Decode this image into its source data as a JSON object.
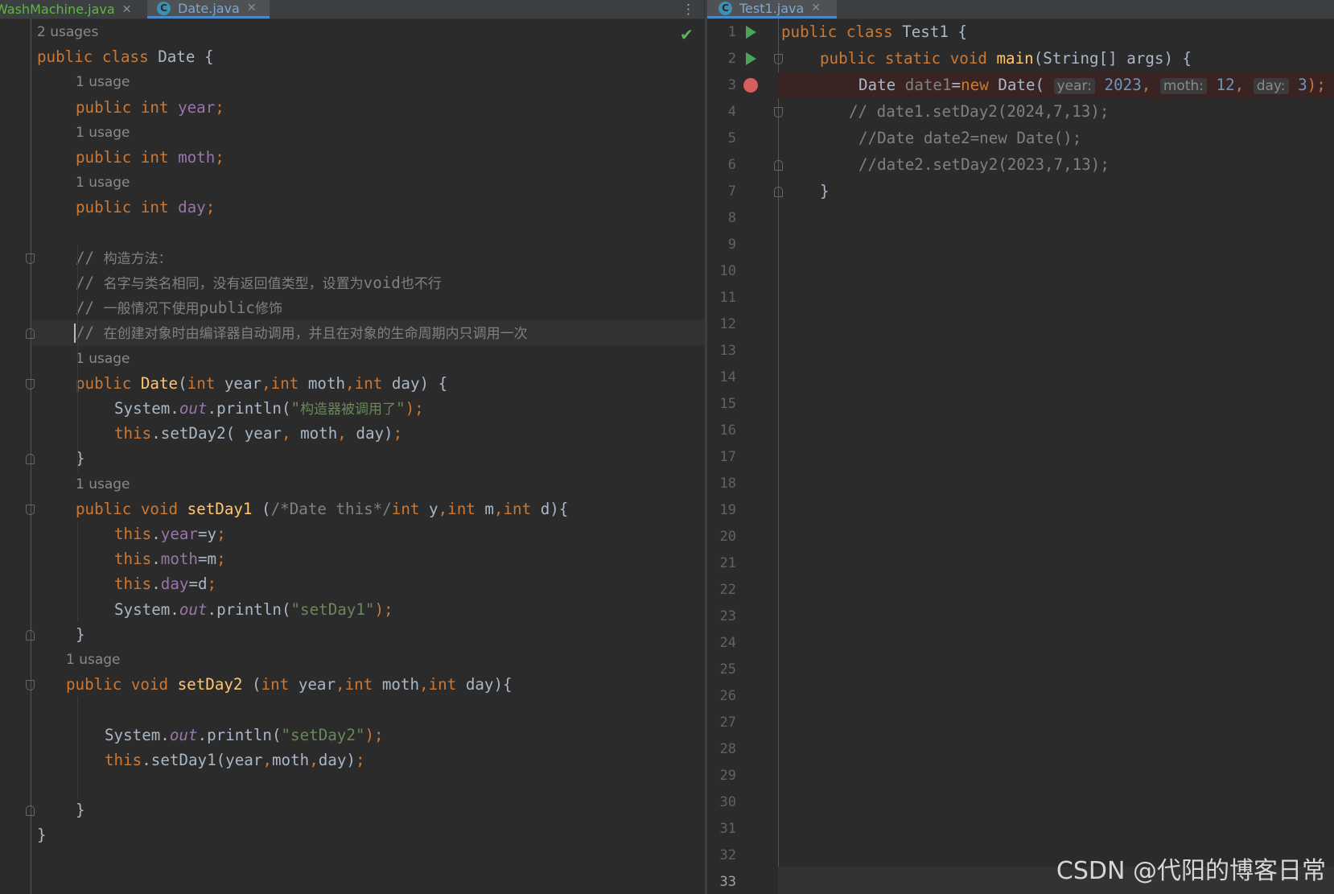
{
  "left_tabs": [
    {
      "name": "WashMachine.java"
    },
    {
      "name": "Date.java",
      "active": true
    }
  ],
  "right_tabs": [
    {
      "name": "Test1.java",
      "active": true
    }
  ],
  "tab_icon_letter": "C",
  "left_editor": {
    "lines": [
      {
        "kind": "usage",
        "indent": 0,
        "text": "2 usages"
      },
      {
        "kind": "code",
        "indent": 0,
        "tokens": [
          {
            "t": "public class ",
            "c": "kw"
          },
          {
            "t": "Date {",
            "c": "plain"
          }
        ]
      },
      {
        "kind": "usage",
        "indent": 1,
        "text": "1 usage"
      },
      {
        "kind": "code",
        "indent": 1,
        "tokens": [
          {
            "t": "public int ",
            "c": "kw"
          },
          {
            "t": "year",
            "c": "fld"
          },
          {
            "t": ";",
            "c": "kw"
          }
        ]
      },
      {
        "kind": "usage",
        "indent": 1,
        "text": "1 usage"
      },
      {
        "kind": "code",
        "indent": 1,
        "tokens": [
          {
            "t": "public int ",
            "c": "kw"
          },
          {
            "t": "moth",
            "c": "fld"
          },
          {
            "t": ";",
            "c": "kw"
          }
        ]
      },
      {
        "kind": "usage",
        "indent": 1,
        "text": "1 usage"
      },
      {
        "kind": "code",
        "indent": 1,
        "tokens": [
          {
            "t": "public int ",
            "c": "kw"
          },
          {
            "t": "day",
            "c": "fld"
          },
          {
            "t": ";",
            "c": "kw"
          }
        ]
      },
      {
        "kind": "blank"
      },
      {
        "kind": "code",
        "indent": 1,
        "tokens": [
          {
            "t": "// ",
            "c": "cmt"
          },
          {
            "t": "构造方法：",
            "c": "cmt cn"
          }
        ]
      },
      {
        "kind": "code",
        "indent": 1,
        "tokens": [
          {
            "t": "// ",
            "c": "cmt"
          },
          {
            "t": "名字与类名相同，没有返回值类型，设置为",
            "c": "cmt cn"
          },
          {
            "t": "void",
            "c": "cmt"
          },
          {
            "t": "也不行",
            "c": "cmt cn"
          }
        ]
      },
      {
        "kind": "code",
        "indent": 1,
        "tokens": [
          {
            "t": "// ",
            "c": "cmt"
          },
          {
            "t": "一般情况下使用",
            "c": "cmt cn"
          },
          {
            "t": "public",
            "c": "cmt"
          },
          {
            "t": "修饰",
            "c": "cmt cn"
          }
        ]
      },
      {
        "kind": "code",
        "indent": 1,
        "caret": true,
        "tokens": [
          {
            "t": "// ",
            "c": "cmt"
          },
          {
            "t": "在创建对象时由编译器自动调用，并且在对象的生命周期内只调用一次",
            "c": "cmt cn"
          }
        ]
      },
      {
        "kind": "usage",
        "indent": 1,
        "text": "1 usage"
      },
      {
        "kind": "code",
        "indent": 1,
        "tokens": [
          {
            "t": "public ",
            "c": "kw"
          },
          {
            "t": "Date",
            "c": "fn"
          },
          {
            "t": "(",
            "c": "plain"
          },
          {
            "t": "int ",
            "c": "kw"
          },
          {
            "t": "year",
            "c": "plain"
          },
          {
            "t": ",",
            "c": "kw"
          },
          {
            "t": "int ",
            "c": "kw"
          },
          {
            "t": "moth",
            "c": "plain"
          },
          {
            "t": ",",
            "c": "kw"
          },
          {
            "t": "int ",
            "c": "kw"
          },
          {
            "t": "day) {",
            "c": "plain"
          }
        ]
      },
      {
        "kind": "code",
        "indent": 2,
        "tokens": [
          {
            "t": "System.",
            "c": "plain"
          },
          {
            "t": "out",
            "c": "it"
          },
          {
            "t": ".println(",
            "c": "plain"
          },
          {
            "t": "\"",
            "c": "str"
          },
          {
            "t": "构造器被调用了",
            "c": "str cn"
          },
          {
            "t": "\"",
            "c": "str"
          },
          {
            "t": ");",
            "c": "kw"
          }
        ]
      },
      {
        "kind": "code",
        "indent": 2,
        "tokens": [
          {
            "t": "this",
            "c": "kw"
          },
          {
            "t": ".setDay2( year",
            "c": "plain"
          },
          {
            "t": ", ",
            "c": "kw"
          },
          {
            "t": "moth",
            "c": "plain"
          },
          {
            "t": ", ",
            "c": "kw"
          },
          {
            "t": "day)",
            "c": "plain"
          },
          {
            "t": ";",
            "c": "kw"
          }
        ]
      },
      {
        "kind": "code",
        "indent": 1,
        "tokens": [
          {
            "t": "}",
            "c": "plain"
          }
        ]
      },
      {
        "kind": "usage",
        "indent": 1,
        "text": "1 usage"
      },
      {
        "kind": "code",
        "indent": 1,
        "tokens": [
          {
            "t": "public void ",
            "c": "kw"
          },
          {
            "t": "setDay1 ",
            "c": "fn"
          },
          {
            "t": "(",
            "c": "plain"
          },
          {
            "t": "/*Date this*/",
            "c": "cmt"
          },
          {
            "t": "int ",
            "c": "kw"
          },
          {
            "t": "y",
            "c": "plain"
          },
          {
            "t": ",",
            "c": "kw"
          },
          {
            "t": "int ",
            "c": "kw"
          },
          {
            "t": "m",
            "c": "plain"
          },
          {
            "t": ",",
            "c": "kw"
          },
          {
            "t": "int ",
            "c": "kw"
          },
          {
            "t": "d){",
            "c": "plain"
          }
        ]
      },
      {
        "kind": "code",
        "indent": 2,
        "tokens": [
          {
            "t": "this",
            "c": "kw"
          },
          {
            "t": ".",
            "c": "plain"
          },
          {
            "t": "year",
            "c": "fld"
          },
          {
            "t": "=y",
            "c": "plain"
          },
          {
            "t": ";",
            "c": "kw"
          }
        ]
      },
      {
        "kind": "code",
        "indent": 2,
        "tokens": [
          {
            "t": "this",
            "c": "kw"
          },
          {
            "t": ".",
            "c": "plain"
          },
          {
            "t": "moth",
            "c": "fld"
          },
          {
            "t": "=m",
            "c": "plain"
          },
          {
            "t": ";",
            "c": "kw"
          }
        ]
      },
      {
        "kind": "code",
        "indent": 2,
        "tokens": [
          {
            "t": "this",
            "c": "kw"
          },
          {
            "t": ".",
            "c": "plain"
          },
          {
            "t": "day",
            "c": "fld"
          },
          {
            "t": "=d",
            "c": "plain"
          },
          {
            "t": ";",
            "c": "kw"
          }
        ]
      },
      {
        "kind": "code",
        "indent": 2,
        "tokens": [
          {
            "t": "System.",
            "c": "plain"
          },
          {
            "t": "out",
            "c": "it"
          },
          {
            "t": ".println(",
            "c": "plain"
          },
          {
            "t": "\"setDay1\"",
            "c": "str"
          },
          {
            "t": ");",
            "c": "kw"
          }
        ]
      },
      {
        "kind": "code",
        "indent": 1,
        "tokens": [
          {
            "t": "}",
            "c": "plain"
          }
        ]
      },
      {
        "kind": "usage",
        "indent": 0.75,
        "text": "1 usage"
      },
      {
        "kind": "code",
        "indent": 0.75,
        "tokens": [
          {
            "t": "public void ",
            "c": "kw"
          },
          {
            "t": "setDay2 ",
            "c": "fn"
          },
          {
            "t": "(",
            "c": "plain"
          },
          {
            "t": "int ",
            "c": "kw"
          },
          {
            "t": "year",
            "c": "plain"
          },
          {
            "t": ",",
            "c": "kw"
          },
          {
            "t": "int ",
            "c": "kw"
          },
          {
            "t": "moth",
            "c": "plain"
          },
          {
            "t": ",",
            "c": "kw"
          },
          {
            "t": "int ",
            "c": "kw"
          },
          {
            "t": "day){",
            "c": "plain"
          }
        ]
      },
      {
        "kind": "blank"
      },
      {
        "kind": "code",
        "indent": 1.75,
        "tokens": [
          {
            "t": "System.",
            "c": "plain"
          },
          {
            "t": "out",
            "c": "it"
          },
          {
            "t": ".println(",
            "c": "plain"
          },
          {
            "t": "\"setDay2\"",
            "c": "str"
          },
          {
            "t": ");",
            "c": "kw"
          }
        ]
      },
      {
        "kind": "code",
        "indent": 1.75,
        "tokens": [
          {
            "t": "this",
            "c": "kw"
          },
          {
            "t": ".setDay1(year",
            "c": "plain"
          },
          {
            "t": ",",
            "c": "kw"
          },
          {
            "t": "moth",
            "c": "plain"
          },
          {
            "t": ",",
            "c": "kw"
          },
          {
            "t": "day)",
            "c": "plain"
          },
          {
            "t": ";",
            "c": "kw"
          }
        ]
      },
      {
        "kind": "blank"
      },
      {
        "kind": "code",
        "indent": 1,
        "tokens": [
          {
            "t": "}",
            "c": "plain"
          }
        ]
      },
      {
        "kind": "code",
        "indent": 0,
        "tokens": [
          {
            "t": "}",
            "c": "plain"
          }
        ]
      }
    ]
  },
  "right_editor": {
    "line_numbers": [
      "1",
      "2",
      "3",
      "4",
      "5",
      "6",
      "7",
      "8",
      "9",
      "10",
      "11",
      "12",
      "13",
      "14",
      "15",
      "16",
      "17",
      "18",
      "19",
      "20",
      "21",
      "22",
      "23",
      "24",
      "25",
      "26",
      "27",
      "28",
      "29",
      "30",
      "31",
      "32",
      "33"
    ],
    "current_line": "33",
    "breakpoint_line": "3",
    "run_lines": [
      "1",
      "2"
    ],
    "lines": [
      {
        "indent": 0,
        "tokens": [
          {
            "t": "public class ",
            "c": "kw"
          },
          {
            "t": "Test1 {",
            "c": "plain"
          }
        ]
      },
      {
        "indent": 1,
        "tokens": [
          {
            "t": "public static void ",
            "c": "kw"
          },
          {
            "t": "main",
            "c": "fn"
          },
          {
            "t": "(String[] args) {",
            "c": "plain"
          }
        ]
      },
      {
        "indent": 2,
        "tokens": [
          {
            "t": "Date ",
            "c": "plain"
          },
          {
            "t": "date1",
            "c": "cmt"
          },
          {
            "t": "=",
            "c": "plain"
          },
          {
            "t": "new ",
            "c": "kw"
          },
          {
            "t": "Date( ",
            "c": "plain"
          },
          {
            "t": "year:",
            "c": "hint"
          },
          {
            "t": " 2023",
            "c": "num"
          },
          {
            "t": ", ",
            "c": "kw"
          },
          {
            "t": "moth:",
            "c": "hint"
          },
          {
            "t": " 12",
            "c": "num"
          },
          {
            "t": ", ",
            "c": "kw"
          },
          {
            "t": "day:",
            "c": "hint"
          },
          {
            "t": " 3",
            "c": "num"
          },
          {
            "t": ");",
            "c": "kw"
          }
        ]
      },
      {
        "indent": 1.75,
        "tokens": [
          {
            "t": "// date1.setDay2(2024,7,13);",
            "c": "cmt"
          }
        ]
      },
      {
        "indent": 2,
        "tokens": [
          {
            "t": "//Date date2=new Date();",
            "c": "cmt"
          }
        ]
      },
      {
        "indent": 2,
        "tokens": [
          {
            "t": "//date2.setDay2(2023,7,13);",
            "c": "cmt"
          }
        ]
      },
      {
        "indent": 1,
        "tokens": [
          {
            "t": "}",
            "c": "plain"
          }
        ]
      }
    ]
  },
  "watermark": "CSDN @代阳的博客日常"
}
